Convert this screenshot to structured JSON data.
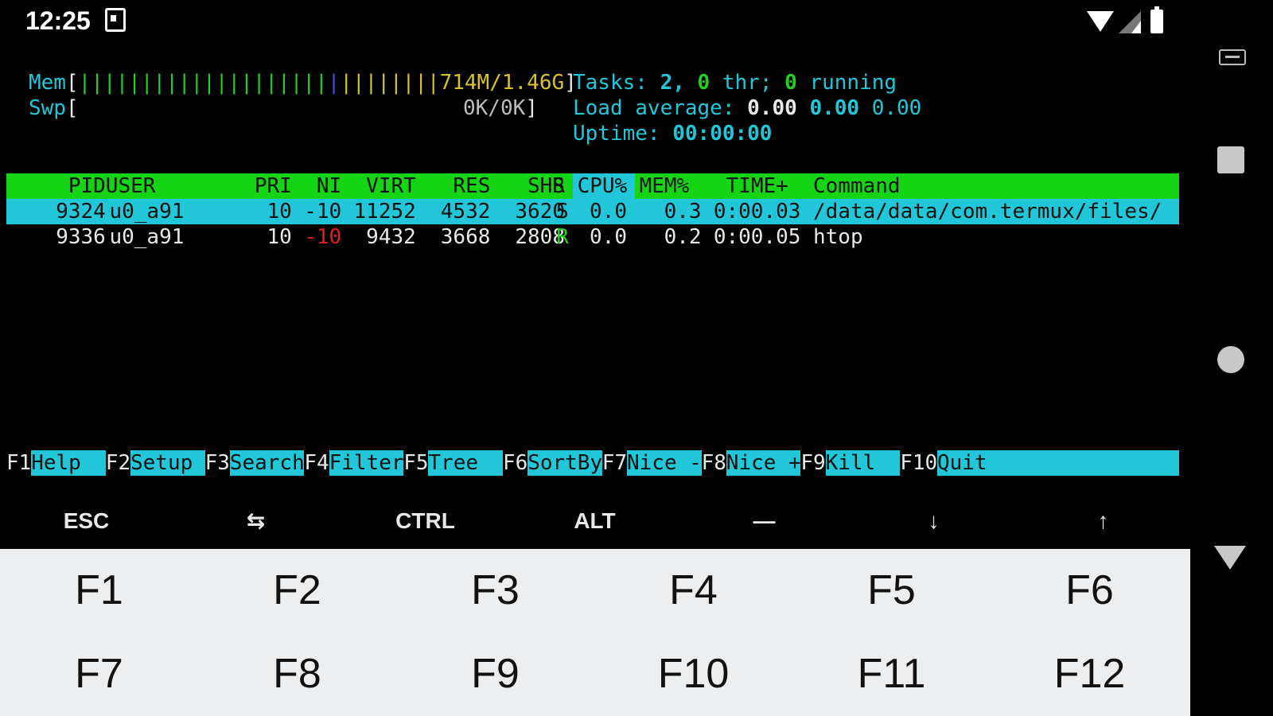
{
  "status_bar": {
    "time": "12:25"
  },
  "header_meters": {
    "mem_label": "Mem",
    "mem_bar_green": "||||||||||||||||||||",
    "mem_bar_blue": "|",
    "mem_bar_yellow": "||||||||",
    "mem_value": "714M/1.46G",
    "mem_close": "]",
    "swp_label": "Swp",
    "swp_value": "0K/0K",
    "swp_close": "]",
    "tasks_label": "Tasks:",
    "tasks_count": "2,",
    "tasks_thr": "0",
    "tasks_thr_label": "thr;",
    "tasks_running": "0",
    "tasks_running_label": "running",
    "load_label": "Load average:",
    "load_1": "0.00",
    "load_5": "0.00",
    "load_15": "0.00",
    "uptime_label": "Uptime:",
    "uptime_value": "00:00:00"
  },
  "process_table": {
    "headers": [
      "PID",
      "USER",
      "PRI",
      "NI",
      "VIRT",
      "RES",
      "SHR",
      "S",
      "CPU%",
      "MEM%",
      "TIME+",
      "Command"
    ],
    "rows": [
      {
        "pid": "9324",
        "user": "u0_a91",
        "pri": "10",
        "ni": "-10",
        "virt": "11252",
        "res": "4532",
        "shr": "3620",
        "s": "S",
        "cpu": "0.0",
        "mem": "0.3",
        "time": "0:00.03",
        "command": "/data/data/com.termux/files/"
      },
      {
        "pid": "9336",
        "user": "u0_a91",
        "pri": "10",
        "ni": "-10",
        "virt": "9432",
        "res": "3668",
        "shr": "2808",
        "s": "R",
        "cpu": "0.0",
        "mem": "0.2",
        "time": "0:00.05",
        "command": "htop"
      }
    ]
  },
  "function_keys": [
    {
      "key": "F1",
      "label": "Help"
    },
    {
      "key": "F2",
      "label": "Setup"
    },
    {
      "key": "F3",
      "label": "Search"
    },
    {
      "key": "F4",
      "label": "Filter"
    },
    {
      "key": "F5",
      "label": "Tree"
    },
    {
      "key": "F6",
      "label": "SortBy"
    },
    {
      "key": "F7",
      "label": "Nice -"
    },
    {
      "key": "F8",
      "label": "Nice +"
    },
    {
      "key": "F9",
      "label": "Kill"
    },
    {
      "key": "F10",
      "label": "Quit"
    }
  ],
  "extra_keys": {
    "esc": "ESC",
    "tab": "⇆",
    "ctrl": "CTRL",
    "alt": "ALT",
    "dash": "—",
    "down": "↓",
    "up": "↑"
  },
  "keyboard": {
    "keys": [
      "F1",
      "F2",
      "F3",
      "F4",
      "F5",
      "F6",
      "F7",
      "F8",
      "F9",
      "F10",
      "F11",
      "F12"
    ]
  },
  "icons": {
    "status": [
      "notification-icon",
      "wifi-icon",
      "signal-icon",
      "battery-icon"
    ],
    "nav": [
      "keyboard-switch-icon",
      "recents-button",
      "home-button",
      "back-button"
    ]
  },
  "colors": {
    "terminal_bg": "#000000",
    "cyan": "#21c7d8",
    "green": "#14d414",
    "yellow": "#d8c228",
    "red": "#e02020",
    "keyboard_bg": "#eceef0"
  }
}
